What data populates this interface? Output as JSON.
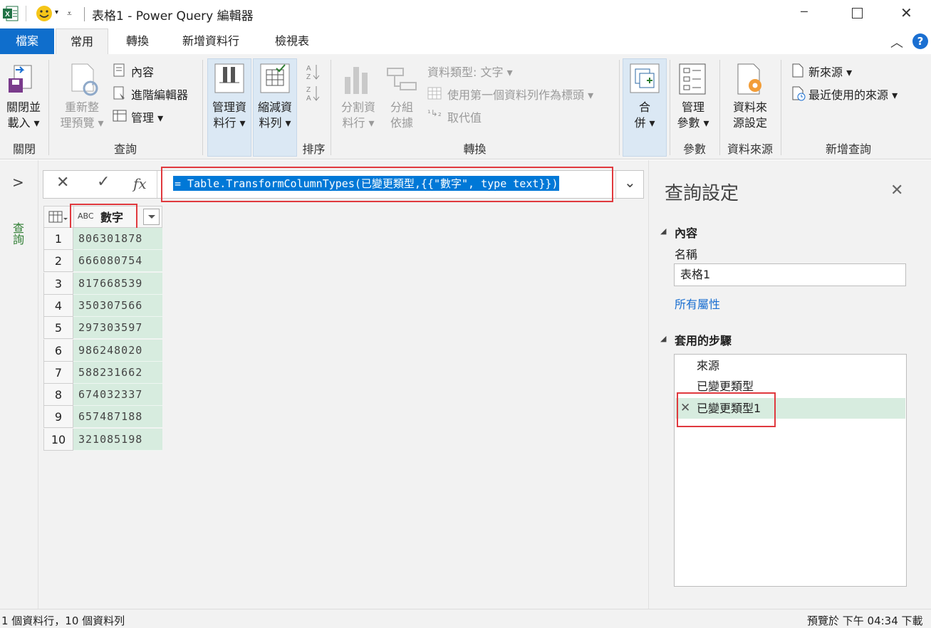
{
  "titlebar": {
    "title": "表格1 - Power Query 編輯器",
    "min_glyph": "─",
    "max_glyph": "☐",
    "close_glyph": "✕"
  },
  "menu": {
    "file": "檔案",
    "tabs": [
      "常用",
      "轉換",
      "新增資料行",
      "檢視表"
    ],
    "help_glyph": "?"
  },
  "ribbon": {
    "close_load": [
      "關閉並",
      "載入 ▾"
    ],
    "refresh": [
      "重新整",
      "理預覽 ▾"
    ],
    "properties": "內容",
    "advanced_editor": "進階編輯器",
    "manage": "管理 ▾",
    "manage_columns": [
      "管理資",
      "料行 ▾"
    ],
    "reduce_rows": [
      "縮減資",
      "料列 ▾"
    ],
    "split_column": [
      "分割資",
      "料行 ▾"
    ],
    "group_by": [
      "分組",
      "依據"
    ],
    "data_type": "資料類型: 文字 ▾",
    "use_first_row": "使用第一個資料列作為標頭 ▾",
    "replace_values": "取代值",
    "combine": [
      "合",
      "併 ▾"
    ],
    "manage_params": [
      "管理",
      "參數 ▾"
    ],
    "data_source_settings": [
      "資料來",
      "源設定"
    ],
    "new_source": "新來源 ▾",
    "recent_sources": "最近使用的來源 ▾",
    "groups": [
      "關閉",
      "查詢",
      "排序",
      "轉換",
      "參數",
      "資料來源",
      "新增查詢"
    ]
  },
  "left_pane": {
    "toggle": ">",
    "label": "查詢"
  },
  "formula": {
    "text": "= Table.TransformColumnTypes(已變更類型,{{\"數字\", type text}})",
    "cancel_glyph": "✕",
    "confirm_glyph": "✓",
    "fx": "fx",
    "expand_glyph": "⌄"
  },
  "table": {
    "type_icon": "ABC",
    "column": "數字",
    "row_numbers": [
      "1",
      "2",
      "3",
      "4",
      "5",
      "6",
      "7",
      "8",
      "9",
      "10"
    ],
    "rows": [
      "806301878",
      "666080754",
      "817668539",
      "350307566",
      "297303597",
      "986248020",
      "588231662",
      "674032337",
      "657487188",
      "321085198"
    ]
  },
  "query_settings": {
    "title": "查詢設定",
    "close_glyph": "✕",
    "properties_header": "內容",
    "name_label": "名稱",
    "name_value": "表格1",
    "all_properties": "所有屬性",
    "steps_header": "套用的步驟",
    "steps": [
      "來源",
      "已變更類型",
      "已變更類型1"
    ],
    "delete_glyph": "✕"
  },
  "status": {
    "left": "1 個資料行，10 個資料列",
    "right": "預覽於 下午 04:34 下載"
  },
  "colors": {
    "file_tab": "#217346",
    "accent_green": "#2e7d32",
    "selection": "#0078d7",
    "highlight_red": "#e0393e",
    "cell_green": "#d7ecdf"
  }
}
